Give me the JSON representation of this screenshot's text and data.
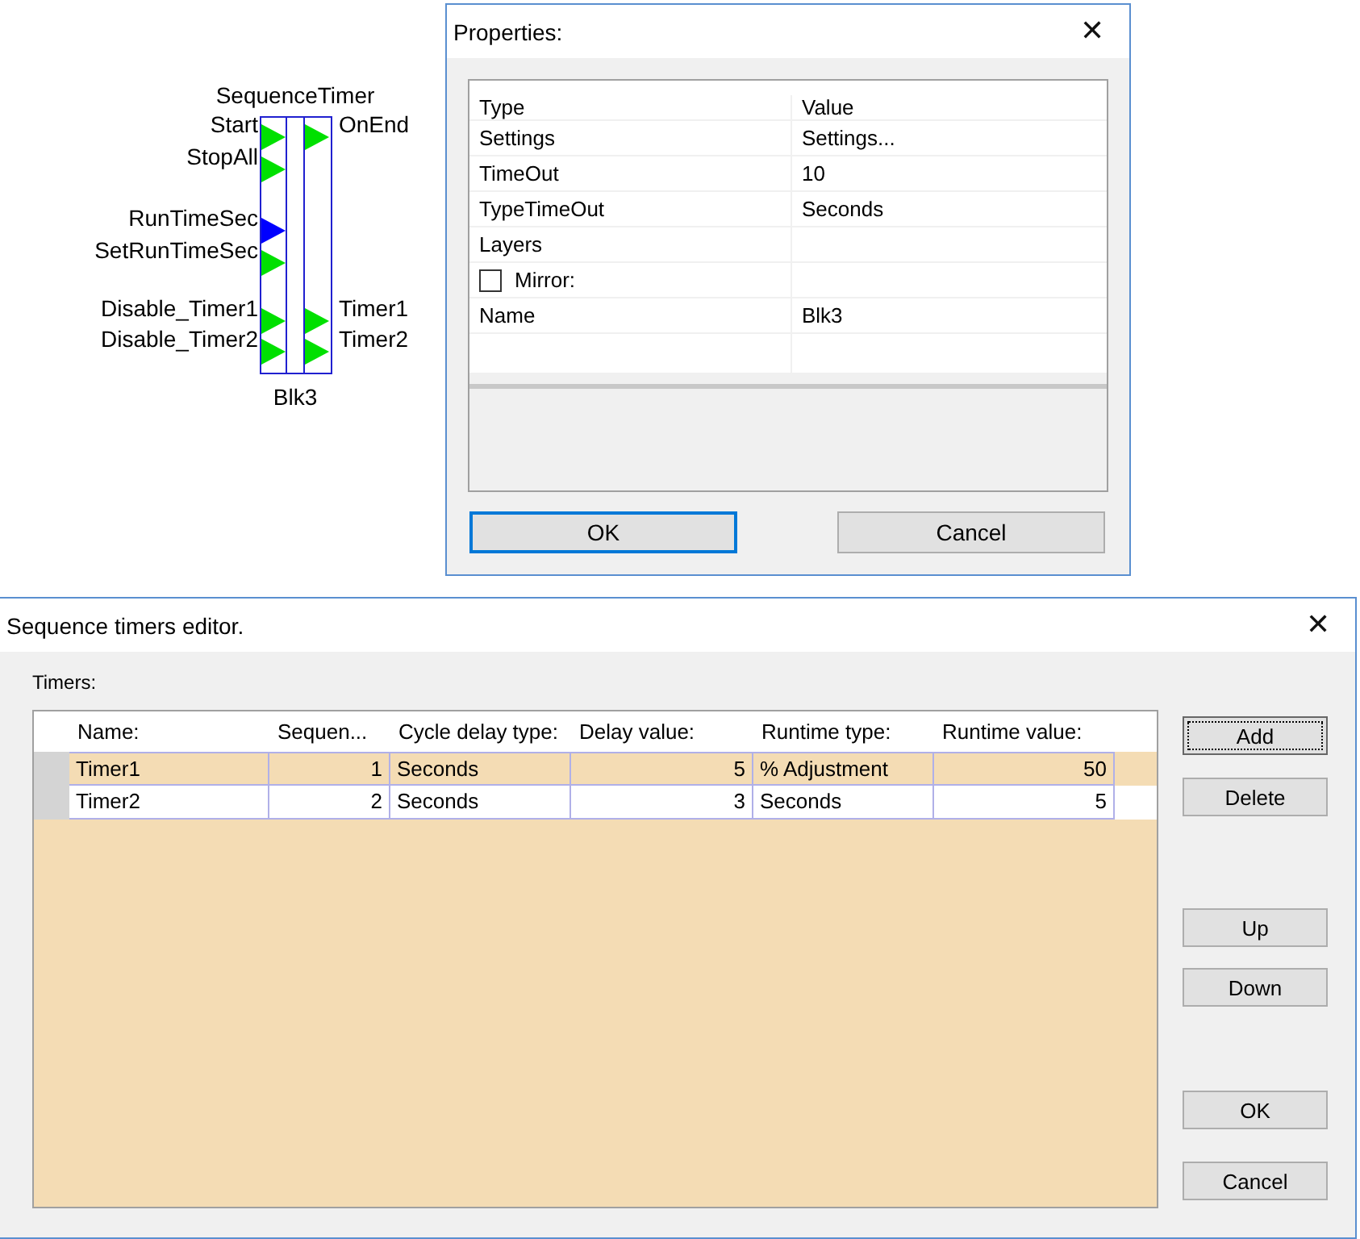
{
  "block": {
    "title": "SequenceTimer",
    "name": "Blk3",
    "inputs": [
      {
        "label": "Start",
        "color": "#00e000"
      },
      {
        "label": "StopAll",
        "color": "#00e000"
      },
      {
        "label": "RunTimeSec",
        "color": "#0000ff"
      },
      {
        "label": "SetRunTimeSec",
        "color": "#00e000"
      },
      {
        "label": "Disable_Timer1",
        "color": "#00e000"
      },
      {
        "label": "Disable_Timer2",
        "color": "#00e000"
      }
    ],
    "outputs": [
      {
        "label": "OnEnd",
        "color": "#00e000"
      },
      {
        "label": "Timer1",
        "color": "#00e000"
      },
      {
        "label": "Timer2",
        "color": "#00e000"
      }
    ]
  },
  "properties_dialog": {
    "title": "Properties:",
    "close": "✕",
    "columns": [
      "Type",
      "Value"
    ],
    "rows": [
      {
        "kind": "text",
        "name": "Settings",
        "value": "Settings..."
      },
      {
        "kind": "text",
        "name": "TimeOut",
        "value": "10"
      },
      {
        "kind": "text",
        "name": "TypeTimeOut",
        "value": "Seconds"
      },
      {
        "kind": "text",
        "name": "Layers",
        "value": ""
      },
      {
        "kind": "checkbox",
        "name": "Mirror:",
        "checked": false
      },
      {
        "kind": "text",
        "name": "Name",
        "value": "Blk3"
      }
    ],
    "buttons": [
      {
        "label": "OK",
        "focused": true
      },
      {
        "label": "Cancel",
        "focused": false
      }
    ]
  },
  "timers_dialog": {
    "title": "Sequence timers editor.",
    "close": "✕",
    "group_label": "Timers:",
    "columns": [
      "Name:",
      "Sequen...",
      "Cycle delay type:",
      "Delay value:",
      "Runtime type:",
      "Runtime value:"
    ],
    "rows": [
      {
        "selected": true,
        "cells": [
          "Timer1",
          "1",
          "Seconds",
          "5",
          "% Adjustment",
          "50"
        ]
      },
      {
        "selected": false,
        "cells": [
          "Timer2",
          "2",
          "Seconds",
          "3",
          "Seconds",
          "5"
        ]
      }
    ],
    "buttons": [
      {
        "label": "Add",
        "focused": true
      },
      {
        "label": "Delete",
        "focused": false
      },
      {
        "label": "Up",
        "focused": false
      },
      {
        "label": "Down",
        "focused": false
      },
      {
        "label": "OK",
        "focused": false
      },
      {
        "label": "Cancel",
        "focused": false
      }
    ]
  }
}
